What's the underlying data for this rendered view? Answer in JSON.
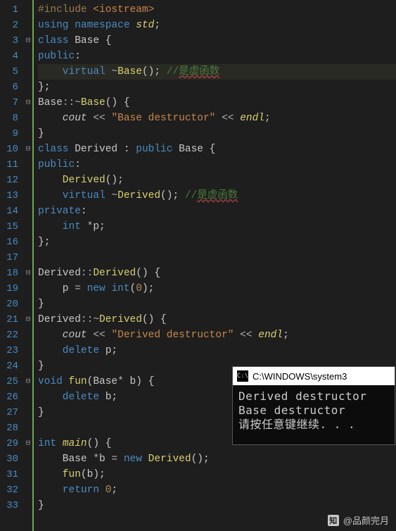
{
  "editor": {
    "total_lines": 33,
    "fold_markers": {
      "3": "⊟",
      "7": "⊟",
      "10": "⊟",
      "18": "⊟",
      "21": "⊟",
      "25": "⊟",
      "29": "⊟"
    },
    "highlighted_line": 5,
    "code": {
      "l1": {
        "t": [
          [
            "pre",
            "#include "
          ],
          [
            "inc",
            "<iostream>"
          ]
        ]
      },
      "l2": {
        "t": [
          [
            "kw",
            "using "
          ],
          [
            "kw",
            "namespace "
          ],
          [
            "funcit",
            "std"
          ],
          [
            "punc",
            ";"
          ]
        ]
      },
      "l3": {
        "t": [
          [
            "kw",
            "class "
          ],
          [
            "cls",
            "Base"
          ],
          [
            "punc",
            " {"
          ]
        ]
      },
      "l4": {
        "t": [
          [
            "kw",
            "public"
          ],
          [
            "punc",
            ":"
          ]
        ]
      },
      "l5": {
        "t": [
          [
            "kw",
            "    virtual "
          ],
          [
            "op",
            "~"
          ],
          [
            "func",
            "Base"
          ],
          [
            "punc",
            "(); "
          ],
          [
            "cmt",
            "//"
          ],
          [
            "cmt err",
            "是虚函数"
          ]
        ]
      },
      "l6": {
        "t": [
          [
            "punc",
            "};"
          ]
        ]
      },
      "l7": {
        "t": [
          [
            "cls",
            "Base"
          ],
          [
            "op",
            "::"
          ],
          [
            "op",
            "~"
          ],
          [
            "func",
            "Base"
          ],
          [
            "punc",
            "() {"
          ]
        ]
      },
      "l8": {
        "t": [
          [
            "obj",
            "    cout"
          ],
          [
            "op",
            " << "
          ],
          [
            "str",
            "\"Base destructor\""
          ],
          [
            "op",
            " << "
          ],
          [
            "funcit",
            "endl"
          ],
          [
            "punc",
            ";"
          ]
        ]
      },
      "l9": {
        "t": [
          [
            "punc",
            "}"
          ]
        ]
      },
      "l10": {
        "t": [
          [
            "kw",
            "class "
          ],
          [
            "cls",
            "Derived"
          ],
          [
            "punc",
            " : "
          ],
          [
            "kw",
            "public "
          ],
          [
            "cls",
            "Base"
          ],
          [
            "punc",
            " {"
          ]
        ]
      },
      "l11": {
        "t": [
          [
            "kw",
            "public"
          ],
          [
            "punc",
            ":"
          ]
        ]
      },
      "l12": {
        "t": [
          [
            "func",
            "    Derived"
          ],
          [
            "punc",
            "();"
          ]
        ]
      },
      "l13": {
        "t": [
          [
            "kw",
            "    virtual "
          ],
          [
            "op",
            "~"
          ],
          [
            "func",
            "Derived"
          ],
          [
            "punc",
            "(); "
          ],
          [
            "cmt",
            "//"
          ],
          [
            "cmt err",
            "是虚函数"
          ]
        ]
      },
      "l14": {
        "t": [
          [
            "kw",
            "private"
          ],
          [
            "punc",
            ":"
          ]
        ]
      },
      "l15": {
        "t": [
          [
            "type",
            "    int "
          ],
          [
            "op",
            "*"
          ],
          [
            "ident",
            "p"
          ],
          [
            "punc",
            ";"
          ]
        ]
      },
      "l16": {
        "t": [
          [
            "punc",
            "};"
          ]
        ]
      },
      "l17": {
        "t": [
          [
            "",
            ""
          ]
        ]
      },
      "l18": {
        "t": [
          [
            "cls",
            "Derived"
          ],
          [
            "op",
            "::"
          ],
          [
            "func",
            "Derived"
          ],
          [
            "punc",
            "() {"
          ]
        ]
      },
      "l19": {
        "t": [
          [
            "ident",
            "    p"
          ],
          [
            "op",
            " = "
          ],
          [
            "kw",
            "new "
          ],
          [
            "type",
            "int"
          ],
          [
            "punc",
            "("
          ],
          [
            "num",
            "0"
          ],
          [
            "punc",
            ");"
          ]
        ]
      },
      "l20": {
        "t": [
          [
            "punc",
            "}"
          ]
        ]
      },
      "l21": {
        "t": [
          [
            "cls",
            "Derived"
          ],
          [
            "op",
            "::"
          ],
          [
            "op",
            "~"
          ],
          [
            "func",
            "Derived"
          ],
          [
            "punc",
            "() {"
          ]
        ]
      },
      "l22": {
        "t": [
          [
            "obj",
            "    cout"
          ],
          [
            "op",
            " << "
          ],
          [
            "str",
            "\"Derived destructor\""
          ],
          [
            "op",
            " << "
          ],
          [
            "funcit",
            "endl"
          ],
          [
            "punc",
            ";"
          ]
        ]
      },
      "l23": {
        "t": [
          [
            "kw",
            "    delete "
          ],
          [
            "ident",
            "p"
          ],
          [
            "punc",
            ";"
          ]
        ]
      },
      "l24": {
        "t": [
          [
            "punc",
            "}"
          ]
        ]
      },
      "l25": {
        "t": [
          [
            "type",
            "void "
          ],
          [
            "func",
            "fun"
          ],
          [
            "punc",
            "("
          ],
          [
            "cls",
            "Base"
          ],
          [
            "op",
            "* "
          ],
          [
            "ident",
            "b"
          ],
          [
            "punc",
            ") {"
          ]
        ]
      },
      "l26": {
        "t": [
          [
            "kw",
            "    delete "
          ],
          [
            "ident",
            "b"
          ],
          [
            "punc",
            ";"
          ]
        ]
      },
      "l27": {
        "t": [
          [
            "punc",
            "}"
          ]
        ]
      },
      "l28": {
        "t": [
          [
            "",
            ""
          ]
        ]
      },
      "l29": {
        "t": [
          [
            "type",
            "int "
          ],
          [
            "funcit",
            "main"
          ],
          [
            "punc",
            "() {"
          ]
        ]
      },
      "l30": {
        "t": [
          [
            "cls",
            "    Base "
          ],
          [
            "op",
            "*"
          ],
          [
            "ident",
            "b"
          ],
          [
            "op",
            " = "
          ],
          [
            "kw",
            "new "
          ],
          [
            "func",
            "Derived"
          ],
          [
            "punc",
            "();"
          ]
        ]
      },
      "l31": {
        "t": [
          [
            "func",
            "    fun"
          ],
          [
            "punc",
            "("
          ],
          [
            "ident",
            "b"
          ],
          [
            "punc",
            ");"
          ]
        ]
      },
      "l32": {
        "t": [
          [
            "kw",
            "    return "
          ],
          [
            "num",
            "0"
          ],
          [
            "punc",
            ";"
          ]
        ]
      },
      "l33": {
        "t": [
          [
            "punc",
            "}"
          ]
        ]
      }
    }
  },
  "console": {
    "title": "C:\\WINDOWS\\system3",
    "icon_text": "C:\\",
    "output": "Derived destructor\nBase destructor\n请按任意键继续. . ."
  },
  "watermark": {
    "logo": "知",
    "text": "@品颜完月"
  }
}
